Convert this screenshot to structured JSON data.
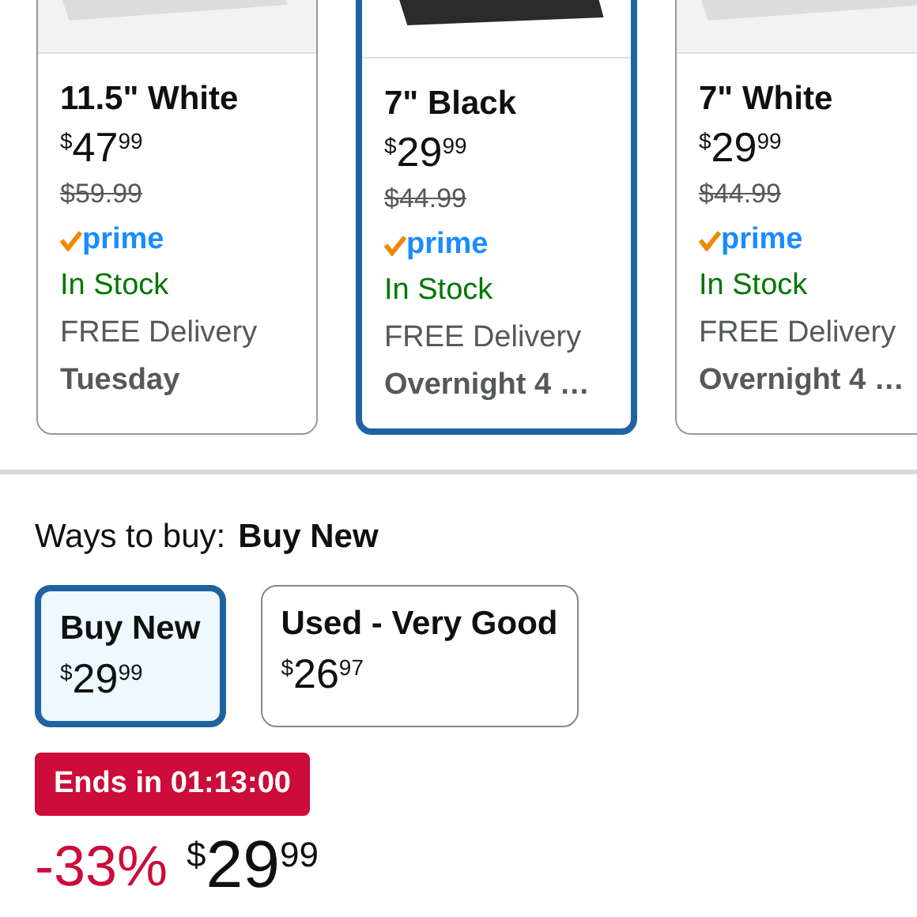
{
  "product_options": [
    {
      "title": "11.5\" White",
      "price": {
        "symbol": "$",
        "whole": "47",
        "fraction": "99"
      },
      "list_price": "$59.99",
      "prime": "prime",
      "availability": "In Stock",
      "delivery": "FREE Delivery",
      "delivery_day": "Tuesday",
      "selected": false
    },
    {
      "title": "7\" Black",
      "price": {
        "symbol": "$",
        "whole": "29",
        "fraction": "99"
      },
      "list_price": "$44.99",
      "prime": "prime",
      "availability": "In Stock",
      "delivery": "FREE Delivery",
      "delivery_day": "Overnight 4 …",
      "selected": true
    },
    {
      "title": "7\" White",
      "price": {
        "symbol": "$",
        "whole": "29",
        "fraction": "99"
      },
      "list_price": "$44.99",
      "prime": "prime",
      "availability": "In Stock",
      "delivery": "FREE Delivery",
      "delivery_day": "Overnight 4 …",
      "selected": false
    }
  ],
  "ways_to_buy": {
    "label": "Ways to buy:",
    "value": "Buy New",
    "options": [
      {
        "label": "Buy New",
        "price": {
          "symbol": "$",
          "whole": "29",
          "fraction": "99"
        },
        "selected": true
      },
      {
        "label": "Used - Very Good",
        "price": {
          "symbol": "$",
          "whole": "26",
          "fraction": "97"
        },
        "selected": false
      }
    ]
  },
  "deal_badge": "Ends in 01:13:00",
  "price_line": {
    "discount": "-33%",
    "price": {
      "symbol": "$",
      "whole": "29",
      "fraction": "99"
    }
  }
}
